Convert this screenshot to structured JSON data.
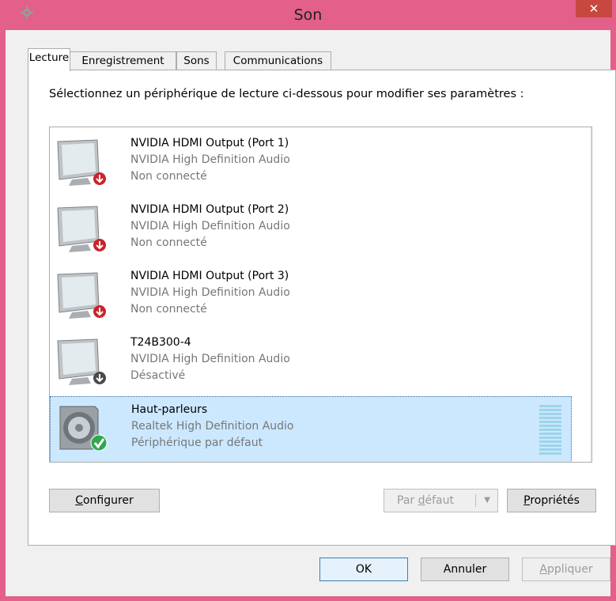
{
  "window": {
    "title": "Son",
    "close_label": "✕"
  },
  "tabs": [
    {
      "label": "Lecture",
      "active": true
    },
    {
      "label": "Enregistrement",
      "active": false
    },
    {
      "label": "Sons",
      "active": false
    },
    {
      "label": "Communications",
      "active": false
    }
  ],
  "instruction": "Sélectionnez un périphérique de lecture ci-dessous pour modifier ses paramètres :",
  "devices": [
    {
      "name": "NVIDIA HDMI Output (Port 1)",
      "driver": "NVIDIA High Definition Audio",
      "status": "Non connecté",
      "icon": "monitor-disconnected-icon",
      "badge": "red-down-arrow"
    },
    {
      "name": "NVIDIA HDMI Output (Port 2)",
      "driver": "NVIDIA High Definition Audio",
      "status": "Non connecté",
      "icon": "monitor-disconnected-icon",
      "badge": "red-down-arrow"
    },
    {
      "name": "NVIDIA HDMI Output (Port 3)",
      "driver": "NVIDIA High Definition Audio",
      "status": "Non connecté",
      "icon": "monitor-disconnected-icon",
      "badge": "red-down-arrow"
    },
    {
      "name": "T24B300-4",
      "driver": "NVIDIA High Definition Audio",
      "status": "Désactivé",
      "icon": "monitor-disabled-icon",
      "badge": "gray-down-arrow"
    },
    {
      "name": "Haut-parleurs",
      "driver": "Realtek High Definition Audio",
      "status": "Périphérique par défaut",
      "icon": "speaker-icon",
      "badge": "green-check",
      "selected": true
    }
  ],
  "buttons": {
    "configure": {
      "pre": "",
      "mnemonic": "C",
      "post": "onfigurer"
    },
    "set_default": {
      "pre": "Par ",
      "mnemonic": "d",
      "post": "éfaut"
    },
    "properties": {
      "pre": "",
      "mnemonic": "P",
      "post": "ropriétés"
    },
    "ok": "OK",
    "cancel": "Annuler",
    "apply": {
      "pre": "",
      "mnemonic": "A",
      "post": "ppliquer"
    }
  },
  "colors": {
    "title_bar": "#e2608a",
    "close_button": "#c7483f",
    "selection": "#cce8ff",
    "disconnected_badge": "#c8242b",
    "default_badge": "#2fa84f"
  }
}
